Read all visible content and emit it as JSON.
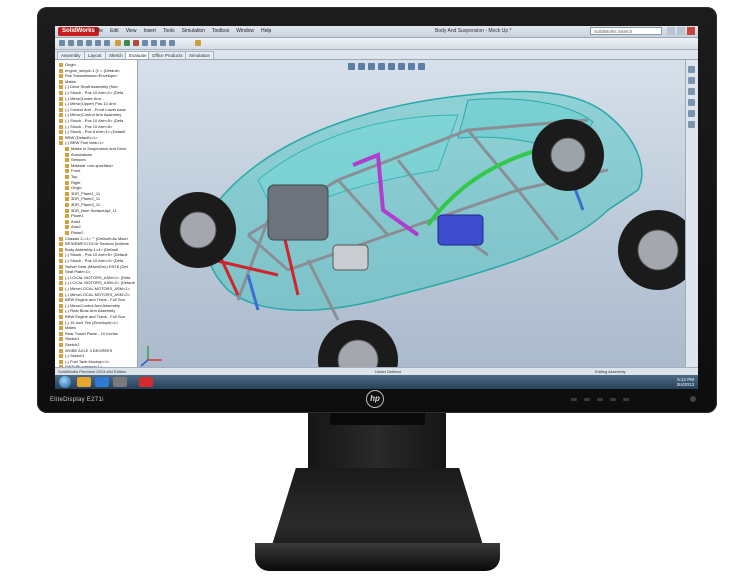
{
  "monitor": {
    "model_label": "EliteDisplay E271i",
    "logo_text": "hp"
  },
  "app": {
    "logo_text": "SolidWorks",
    "menu": [
      "File",
      "Edit",
      "View",
      "Insert",
      "Tools",
      "Simulation",
      "Toolbox",
      "Window",
      "Help"
    ],
    "document_title": "Body And Suspension - Mock Up *",
    "search_placeholder": "SolidWorks Search"
  },
  "command_tabs": [
    "Assembly",
    "Layout",
    "Sketch",
    "Evaluate",
    "Office Products",
    "Simulation"
  ],
  "active_tab": "Evaluate",
  "feature_tree": [
    "Origin",
    "engine_simple-1 (1 > (Default<",
    "Fiat Transmission<Envelope>",
    "Mates",
    "(-) Drive Shaft Assembly (Nev",
    "(-) Shock - Pos 10 Arm<1> (Defa",
    "(-) Mirror(Lower Arm...",
    "(-) Mirror(Upper) Pos 10 Arm",
    "(-) Control Arm - Front Lower Asse",
    "(-) Mirror(Control Arm Assembly",
    "(-) Shock - Pos 10 Arm<5> (Defa",
    "(-) Shock - Pos 10 Arm<5>",
    "(-) Shock - Pos 8 Arm<1> (Default",
    "BRW (Default)<1>",
    "(-) BRW Fuel tank<1>",
    "Mates in Suspension and Drive",
    "Annotations",
    "Sensors",
    "Material <not specified>",
    "Front",
    "Top",
    "Right",
    "Origin",
    "3DR_Plane1_11",
    "3DR_Plane2_11",
    "3DR_Plane3_11",
    "3DR_Bum SurfaceApt_11",
    "Plane1",
    "Axis1",
    "Axis2",
    "Plane2",
    "Chassis 2-<1> \"\" (Default<As Mach",
    "BP30RMFG7OC4r Sectioni (Intitchs",
    "Body Assembly-1<4> (Default",
    "(-) Shock - Pos 10 Arm<5> (Default",
    "(-) Shock - Pos 10 Arm<4> (Defa",
    "Swivel Gear (MachGen) ENT8 (Def",
    "Seat Plate<1>",
    "(-) LOCAL MOTORS_ASM<1> (Defa",
    "(-) LOCAL MOTORS_ASM<2> (Default",
    "(-) MirrorLOCAL MOTORS_ASM<1>",
    "(-) MirrorLOCAL MOTORS_ASM<2>",
    "BRW Engine and Trans - Full Sca",
    "(-) MirrorControl Arm Assembly",
    "(-) Rear Blutz Arm Assembly",
    "BRW Engine and Trans - Full Sca",
    "(-) 16 Inch Tire (Envelope)<1>",
    "Mates",
    "Rear Travel Plane - 10 Inches",
    "Sketch1",
    "Sketch2",
    "WOBE AXLE 3 DEGREES",
    "(-) Sketch1",
    "(-) Fuel Tank Mockup<1>",
    "SWTwPr-camera<1>"
  ],
  "status_bar": {
    "left": "SolidWorks Premium 2013 x64 Edition",
    "middle": "Under Defined",
    "right": "Editing Assembly"
  },
  "taskbar": {
    "time": "5:12 PM",
    "date": "3/4/2013"
  }
}
